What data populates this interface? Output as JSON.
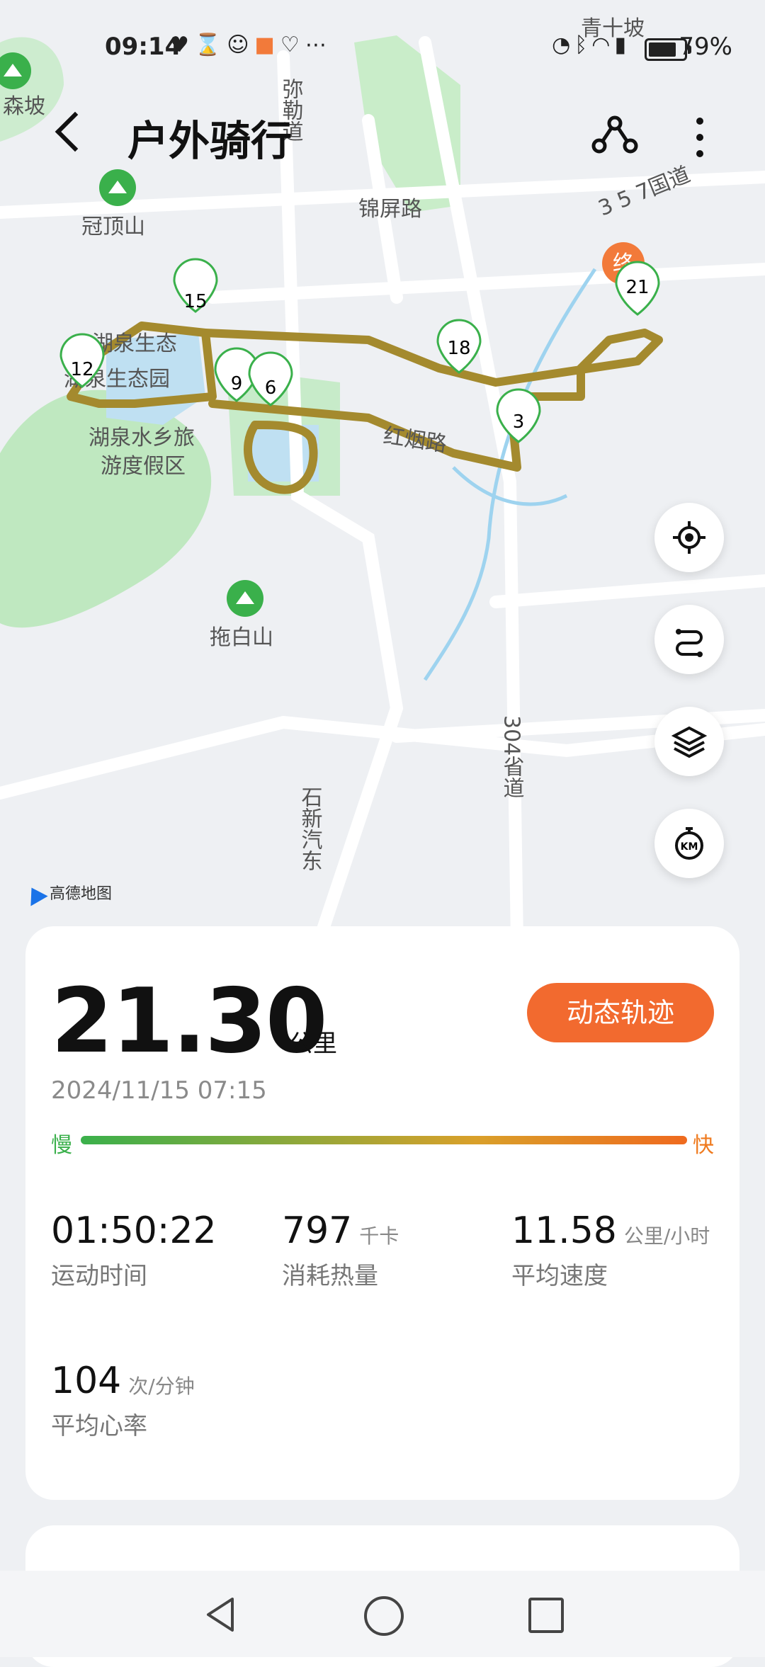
{
  "status_bar": {
    "time": "09:14",
    "left_icons": [
      "heart-shield-icon",
      "hourglass-icon",
      "wechat-icon",
      "orange-app-icon",
      "health-icon",
      "more-dots-icon"
    ],
    "right_icons": [
      "speed-icon",
      "bluetooth-icon",
      "wifi-icon",
      "4g-signal-icon"
    ],
    "battery_percent": 79,
    "battery_text": "79%"
  },
  "header": {
    "title": "户外骑行",
    "actions": [
      "share-route-icon",
      "more-options-icon"
    ]
  },
  "map": {
    "provider": "高德地图",
    "labels": {
      "senpo": "森坡",
      "qingshipo": "青十坡",
      "mile_road": "弥勒道",
      "guanding": "冠顶山",
      "jinping": "锦屏路",
      "highway357": "3 5 7国道",
      "hq_eco1": "湖泉生态",
      "hq_eco2": "湖泉生态园",
      "hq_resort1": "湖泉水乡旅",
      "hq_resort2": "游度假区",
      "road_mid": "红烟路",
      "tuobai": "拖白山",
      "shixin": "石新汽东",
      "prov304": "304省道"
    },
    "km_markers": [
      "15",
      "12",
      "9",
      "6",
      "18",
      "3",
      "21"
    ],
    "end_marker": "终",
    "controls": [
      "locate-icon",
      "route-toggle-icon",
      "layers-icon",
      "km-marker-icon"
    ],
    "colors": {
      "water": "#bfe0f2",
      "park": "#bfe8c0",
      "route": "#a48a2e",
      "marker": "#3ab04b",
      "end": "#f27a3a"
    }
  },
  "summary": {
    "distance": "21.30",
    "distance_unit": "公里",
    "dynamic_track_button": "动态轨迹",
    "datetime": "2024/11/15 07:15",
    "pace_slow": "慢",
    "pace_fast": "快",
    "stats": [
      {
        "value": "01:50:22",
        "unit": "",
        "label": "运动时间"
      },
      {
        "value": "797",
        "unit": "千卡",
        "label": "消耗热量"
      },
      {
        "value": "11.58",
        "unit": "公里/小时",
        "label": "平均速度"
      },
      {
        "value": "104",
        "unit": "次/分钟",
        "label": "平均心率"
      }
    ]
  },
  "nav_bar": [
    "back-nav-icon",
    "home-nav-icon",
    "recents-nav-icon"
  ]
}
